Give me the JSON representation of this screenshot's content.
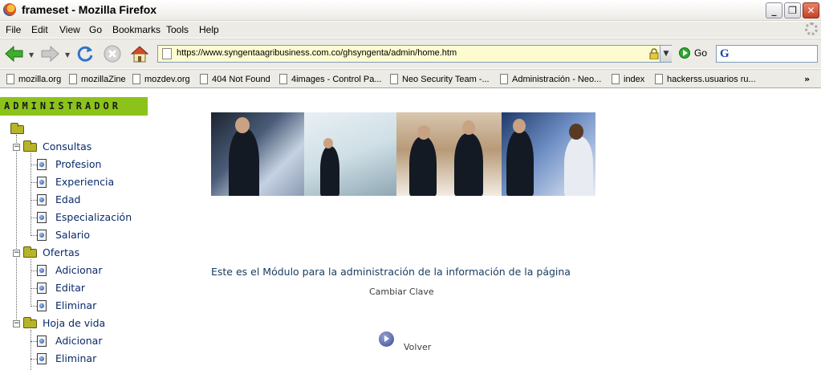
{
  "window": {
    "title": "frameset - Mozilla Firefox",
    "buttons": {
      "minimize": "_",
      "maximize": "❐",
      "close": "✕"
    }
  },
  "menu": [
    "File",
    "Edit",
    "View",
    "Go",
    "Bookmarks",
    "Tools",
    "Help"
  ],
  "navigation": {
    "url": "https://www.syngentaagribusiness.com.co/ghsyngenta/admin/home.htm",
    "go_label": "Go",
    "search_icon_letter": "G"
  },
  "bookmarks": [
    "mozilla.org",
    "mozillaZine",
    "mozdev.org",
    "404 Not Found",
    "4images - Control Pa...",
    "Neo Security Team -...",
    "Administración - Neo...",
    "index",
    "hackerss.usuarios ru..."
  ],
  "bookmarks_overflow": "»",
  "sidebar": {
    "header": "ADMINISTRADOR",
    "groups": [
      {
        "label": "Consultas",
        "items": [
          "Profesion",
          "Experiencia",
          "Edad",
          "Especialización",
          "Salario"
        ]
      },
      {
        "label": "Ofertas",
        "items": [
          "Adicionar",
          "Editar",
          "Eliminar"
        ]
      },
      {
        "label": "Hoja de vida",
        "items": [
          "Adicionar",
          "Eliminar"
        ]
      }
    ]
  },
  "main": {
    "message": "Este es el Módulo para la administración de la información de la página",
    "change_password": "Cambiar Clave",
    "back": "Volver"
  },
  "colors": {
    "admin_header_bg": "#8cc31a",
    "tree_text": "#0a2a6a",
    "main_text": "#163a5f",
    "url_bg": "#fffbd0"
  }
}
